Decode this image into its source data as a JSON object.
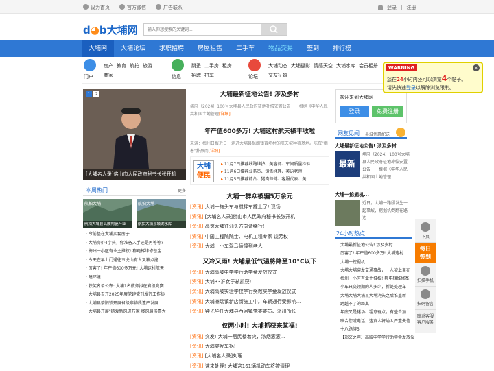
{
  "topbar": {
    "links": [
      {
        "label": "设为首页",
        "icon": "home-icon"
      },
      {
        "label": "官方微信",
        "icon": "wechat-icon"
      },
      {
        "label": "广告联系",
        "icon": "ad-icon"
      }
    ],
    "login": "登录",
    "sep": "|",
    "register": "注册"
  },
  "header": {
    "logo_a": "d",
    "logo_o": "◕",
    "logo_b": "b",
    "logo_name": "大埔网",
    "search_placeholder": "输入你想搜索的关键词..."
  },
  "nav": [
    "大埔网",
    "大埔论坛",
    "求职招聘",
    "房屋租售",
    "二手车",
    "物品交易",
    "签到",
    "排行榜"
  ],
  "subnav": [
    {
      "label": "门户",
      "links": [
        "房产",
        "教育",
        "航拍",
        "旅游",
        "商家"
      ]
    },
    {
      "label": "信息",
      "links": [
        "跳蚤",
        "二手房",
        "租房",
        "招聘",
        "拼车"
      ]
    },
    {
      "label": "论坛",
      "links": [
        "大埔动态",
        "大埔摄影",
        "情感天空",
        "大埔水库",
        "会员相册",
        "交友征婚"
      ]
    }
  ],
  "carousel": {
    "pages": [
      "1",
      "2"
    ],
    "caption": "[大埔名人录]佛山市人民政府秘书长张开机"
  },
  "hot": {
    "title": "本周热门",
    "more": "更多",
    "pics": [
      {
        "tag": "航拍大埔",
        "cap": "航拍大埔县高陂陶瓷产业"
      },
      {
        "tag": "航拍大埔",
        "cap": "航拍大埔县城湖水库"
      }
    ],
    "list": [
      "今前整在大埔买套房子",
      "大埔房价4字头，你准备入手还是再等等?",
      "梅州一小区有业主推权! 称电梯维修基金",
      "今天在早上门通往五虎山有人又被点撞",
      "厉害了! 年产值600多万元! 大埔这村航天",
      "建环境",
      "获奖名单公布: 大埔1名教师拟在省级竞赛",
      "大埔县召开2025年度党建党刊发行工作协",
      "大埔县茶阳镇开展省级非物质遗产发展",
      "大埔县开展\"链爱新风进万家 移风易俗喜大"
    ]
  },
  "center": {
    "a1": {
      "title": "大埔最新征地公告! 涉及多村",
      "desc": "埔府（2024）100号大埔县人民政府征地补偿安置公告　　根据《中华人民共和国土地管理",
      "more": "[详细]"
    },
    "a2": {
      "title": "年产值600多万! 大埔这村航天椒丰收啦",
      "desc": "来源：梅州日报近日，走进大埔县枫朗镇百坪村的航天椒种植基地。陈辉\"摘着\"扑鼻而",
      "more": "[详细]"
    },
    "bianmin": {
      "b1": "大埔",
      "b2": "便民",
      "rows": [
        "11月7日推荐线路维护、美容师、车间质量检验",
        "11月6日推荐业务员、销售经理、英语老师",
        "11月5日推荐前台、猪肉师傅、客服代表、美"
      ]
    },
    "s1": {
      "title": "大埔一群众被骗5万余元",
      "items": [
        [
          "[资讯]",
          "大埔一拖头车与搅拌车撞上了! 现场..."
        ],
        [
          "[资讯]",
          "[大埔名人录]佛山市人民政府秘书长张开机"
        ],
        [
          "[资讯]",
          "高速大埔往汕头方向请绕行!"
        ],
        [
          "[资讯]",
          "中国工程院院士、电机工程专家 饶芳权"
        ],
        [
          "[资讯]",
          "大埔一小车驾马猛撞到老人"
        ]
      ]
    },
    "s2": {
      "title": "又冷又雨! 大埔最低气温将降至10°C以下",
      "items": [
        [
          "[资讯]",
          "大埔高陂中学学行助学金发放仪式"
        ],
        [
          "[资讯]",
          "大埔33岁女子被抓获!"
        ],
        [
          "[资讯]",
          "大埔高陂实验学校学行奖教奖学金发放仪式"
        ],
        [
          "[资讯]",
          "大埔洲瑞镇新店街施工中。车辆通行受影响..."
        ],
        [
          "[资讯]",
          "钟光华任大埔县西河镇党委委员、派出所长"
        ]
      ]
    },
    "s3": {
      "title": "仅两小时! 大埔抓获来某福!",
      "items": [
        [
          "[资讯]",
          "突发! 大埔一居民楼着火，浓烟滚滚..."
        ],
        [
          "[资讯]",
          "大埔突发车祸!"
        ],
        [
          "[资讯]",
          "[大埔名人录]刘理"
        ],
        [
          "[资讯]",
          "速来处理! 大埔这161辆机动车将被清理"
        ]
      ]
    }
  },
  "right": {
    "welcome": "欢迎来到大埔网",
    "login": "登录",
    "register": "免费注册",
    "tabs": {
      "a": "网友见闻",
      "b": "县城优惠配送"
    },
    "ra1": {
      "title": "大埔最新征地公告! 涉及多村",
      "thumb": "最新",
      "desc": "埔府（2024）100号大埔县人民政府征地补偿安置公告　　根据《中华人民共和国土地管理"
    },
    "ra2": {
      "title": "大埔一挖掘机...",
      "desc": "近日，大埔一路段发生一起事故，挖掘机倒翻在路边……"
    },
    "h24title": "24小时热点",
    "h24": [
      "大埔最新征地公告! 涉及多村",
      "厉害了! 年产值600多万! 大埔这村",
      "大埔一挖掘机...",
      "大埔大埔突发交通事故，一人被上盖在",
      "梅州一小区有业主推权! 称电梯维修基",
      "小车只交领期的人多少，新处处理车",
      "大埔大埔大埔县大埔消失之后谁重新",
      "跨越不了的距离",
      "年底又是猪场、粗意有点，有些个加",
      "联合您或电话，这真人将纳入严重失信",
      "十八路牌5",
      "【郑文之声】高陂中学学行助学金发放仪式"
    ]
  },
  "warning": {
    "tag": "WARNING",
    "close": "×",
    "l1a": "您在",
    "l1b": "24",
    "l1c": "小时内还可以浏览",
    "l1d": "4",
    "l1e": "个帖子。",
    "l2a": "请先快速",
    "l2b": "登录",
    "l2c": "以解除浏览限制。"
  },
  "float": {
    "down": "下页",
    "sign1": "每日",
    "sign2": "签到",
    "app": "扫描手机",
    "chat": "扫码留言",
    "service": "联系客服",
    "cs2": "客户服务"
  }
}
